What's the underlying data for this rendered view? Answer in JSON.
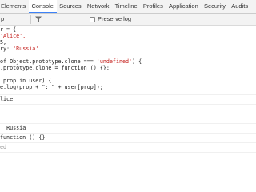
{
  "tabs": [
    "Elements",
    "Console",
    "Sources",
    "Network",
    "Timeline",
    "Profiles",
    "Application",
    "Security",
    "Audits"
  ],
  "active_tab_index": 1,
  "toolbar": {
    "context": "p",
    "preserve_log_label": "Preserve log",
    "preserve_log_checked": false
  },
  "console": {
    "input_lines": [
      [
        "r = {",
        ""
      ],
      [
        "'Alice',",
        ""
      ],
      [
        "5,",
        ""
      ],
      [
        "ry: ",
        "'Russia'"
      ],
      [
        "",
        ""
      ],
      [
        "of Object.prototype.clone === ",
        "'undefined'",
        ") {"
      ],
      [
        ".prototype.clone = function () {};",
        ""
      ],
      [
        "",
        ""
      ],
      [
        " prop in user) {",
        ""
      ],
      [
        "e.log(prop + \": \" + user[prop]);",
        ""
      ]
    ],
    "output_lines": [
      "lice",
      "",
      "",
      "Russia",
      "function () {}"
    ],
    "result": "ed"
  }
}
